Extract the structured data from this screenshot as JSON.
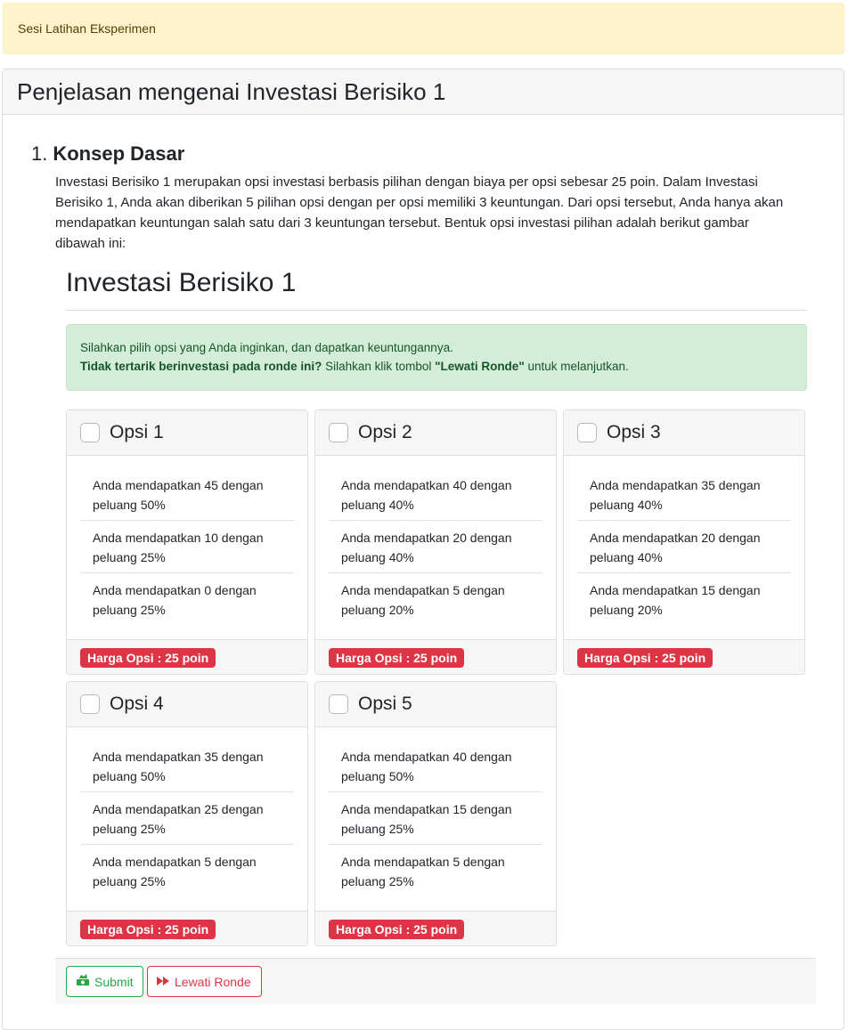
{
  "banner": {
    "text": "Sesi Latihan Eksperimen"
  },
  "panel": {
    "title": "Penjelasan mengenai Investasi Berisiko 1"
  },
  "concept": {
    "number": "1.",
    "title": "Konsep Dasar",
    "text": "Investasi Berisiko 1 merupakan opsi investasi berbasis pilihan dengan biaya per opsi sebesar 25 poin. Dalam Investasi Berisiko 1, Anda akan diberikan 5 pilihan opsi dengan per opsi memiliki 3 keuntungan. Dari opsi tersebut, Anda hanya akan mendapatkan keuntungan salah satu dari 3 keuntungan tersebut. Bentuk opsi investasi pilihan adalah berikut gambar dibawah ini:"
  },
  "investment": {
    "title": "Investasi Berisiko 1",
    "alert_line1": "Silahkan pilih opsi yang Anda inginkan, dan dapatkan keuntungannya.",
    "alert_bold": "Tidak tertarik berinvestasi pada ronde ini?",
    "alert_mid": " Silahkan klik tombol ",
    "alert_button_ref": "\"Lewati Ronde\"",
    "alert_end": " untuk melanjutkan."
  },
  "options": [
    {
      "label": "Opsi 1",
      "checked": false,
      "price": "Harga Opsi : 25 poin",
      "outcomes": [
        "Anda mendapatkan 45 dengan peluang 50%",
        "Anda mendapatkan 10 dengan peluang 25%",
        "Anda mendapatkan 0 dengan peluang 25%"
      ]
    },
    {
      "label": "Opsi 2",
      "checked": false,
      "price": "Harga Opsi : 25 poin",
      "outcomes": [
        "Anda mendapatkan 40 dengan peluang 40%",
        "Anda mendapatkan 20 dengan peluang 40%",
        "Anda mendapatkan 5 dengan peluang 20%"
      ]
    },
    {
      "label": "Opsi 3",
      "checked": false,
      "price": "Harga Opsi : 25 poin",
      "outcomes": [
        "Anda mendapatkan 35 dengan peluang 40%",
        "Anda mendapatkan 20 dengan peluang 40%",
        "Anda mendapatkan 15 dengan peluang 20%"
      ]
    },
    {
      "label": "Opsi 4",
      "checked": false,
      "price": "Harga Opsi : 25 poin",
      "outcomes": [
        "Anda mendapatkan 35 dengan peluang 50%",
        "Anda mendapatkan 25 dengan peluang 25%",
        "Anda mendapatkan 5 dengan peluang 25%"
      ]
    },
    {
      "label": "Opsi 5",
      "checked": false,
      "price": "Harga Opsi : 25 poin",
      "outcomes": [
        "Anda mendapatkan 40 dengan peluang 50%",
        "Anda mendapatkan 15 dengan peluang 25%",
        "Anda mendapatkan 5 dengan peluang 25%"
      ]
    }
  ],
  "buttons": {
    "submit_label": "Submit",
    "submit_icon": "money-bill-icon",
    "skip_label": "Lewati Ronde",
    "skip_icon": "fast-forward-icon"
  },
  "colors": {
    "warning_bg": "#fff3cd",
    "success_bg": "#d4edda",
    "danger": "#dc3545",
    "success": "#28a745"
  }
}
